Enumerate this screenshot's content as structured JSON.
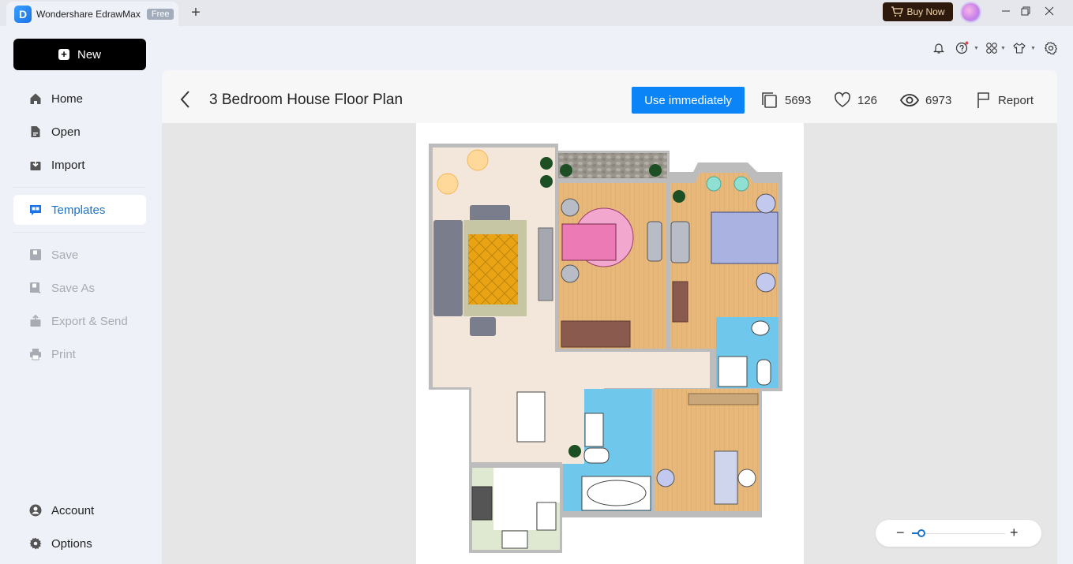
{
  "app": {
    "tab_title": "Wondershare EdrawMax",
    "tab_badge": "Free",
    "logo_letter": "D",
    "buy_now_label": "Buy Now",
    "window_controls": [
      "minimize",
      "restore",
      "close"
    ]
  },
  "sidebar": {
    "new_label": "New",
    "items": [
      {
        "label": "Home",
        "icon": "home-icon",
        "state": "normal"
      },
      {
        "label": "Open",
        "icon": "file-icon",
        "state": "normal"
      },
      {
        "label": "Import",
        "icon": "import-icon",
        "state": "normal"
      },
      {
        "label": "Templates",
        "icon": "templates-icon",
        "state": "active"
      },
      {
        "label": "Save",
        "icon": "save-icon",
        "state": "disabled"
      },
      {
        "label": "Save As",
        "icon": "save-as-icon",
        "state": "disabled"
      },
      {
        "label": "Export & Send",
        "icon": "export-icon",
        "state": "disabled"
      },
      {
        "label": "Print",
        "icon": "print-icon",
        "state": "disabled"
      }
    ],
    "bottom_items": [
      {
        "label": "Account",
        "icon": "account-icon"
      },
      {
        "label": "Options",
        "icon": "gear-icon"
      }
    ]
  },
  "toolbar_icons": [
    "bell-icon",
    "help-icon",
    "apps-icon",
    "theme-icon",
    "settings-icon"
  ],
  "template": {
    "title": "3 Bedroom House Floor Plan",
    "use_button_label": "Use immediately",
    "stats": {
      "copies": "5693",
      "likes": "126",
      "views": "6973"
    },
    "report_label": "Report"
  },
  "zoom": {
    "level_fraction": 0.1
  },
  "colors": {
    "accent": "#0b84f7",
    "active_nav": "#1a73c8",
    "buy_now_bg": "#2e1a0c"
  }
}
